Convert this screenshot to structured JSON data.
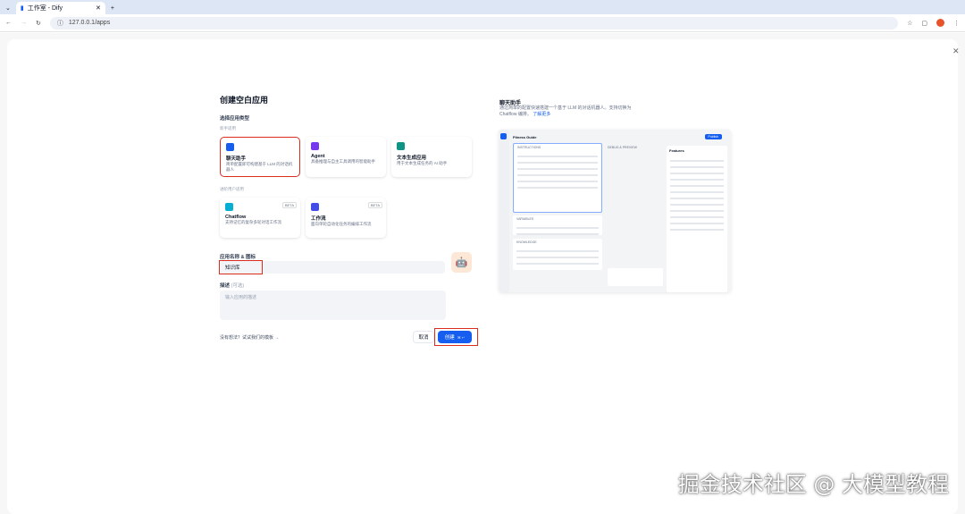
{
  "browser": {
    "tab_title": "工作室 - Dify",
    "url": "127.0.0.1/apps"
  },
  "modal": {
    "title": "创建空白应用",
    "choose_type": "选择应用类型",
    "beginner": "新手适用",
    "advanced": "进阶用户适用",
    "types": [
      {
        "name": "聊天助手",
        "desc": "简单配置即可构建基于 LLM 的对话机器人",
        "color": "#155eef"
      },
      {
        "name": "Agent",
        "desc": "具备推理与自主工具调用的智能助手",
        "color": "#7839ee"
      },
      {
        "name": "文本生成应用",
        "desc": "用于文本生成任务的 AI 助手",
        "color": "#0e9384"
      },
      {
        "name": "Chatflow",
        "desc": "支持记忆的复杂多轮对话工作流",
        "badge": "BETA",
        "color": "#06aed4"
      },
      {
        "name": "工作流",
        "desc": "面向单轮自动化任务的编排工作流",
        "badge": "BETA",
        "color": "#444ce7"
      }
    ],
    "name_label": "应用名称 & 图标",
    "name_value": "知识库",
    "desc_label": "描述",
    "desc_optional": "(可选)",
    "desc_placeholder": "输入应用的描述",
    "template_link": "没有想法？试试我们的模板 →",
    "cancel": "取消",
    "create": "创建",
    "create_shortcut": "⌘ ↵"
  },
  "preview": {
    "title": "聊天助手",
    "desc": "通过简单的配置快速搭建一个基于 LLM 的对话机器人。支持切换为 Chatflow 编排。",
    "learn_more": "了解更多",
    "app_name": "Fitness Guide",
    "instructions": "INSTRUCTIONS",
    "debug": "DEBUG & PREVIEW",
    "features": "Features",
    "variables": "VARIABLES",
    "knowledge": "KNOWLEDGE",
    "publish": "Publish"
  },
  "watermark": "掘金技术社区 @ 大模型教程"
}
